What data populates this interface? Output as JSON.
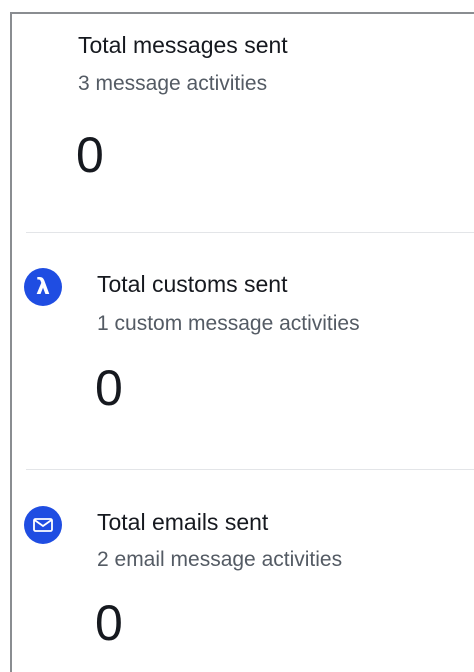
{
  "metrics": [
    {
      "title": "Total messages sent",
      "subtitle": "3 message activities",
      "value": "0"
    },
    {
      "title": "Total customs sent",
      "subtitle": "1 custom message activities",
      "value": "0",
      "icon": "lambda-icon",
      "icon_glyph": "λ"
    },
    {
      "title": "Total emails sent",
      "subtitle": "2 email message activities",
      "value": "0",
      "icon": "envelope-icon"
    }
  ],
  "colors": {
    "icon_bg": "#1f4de2",
    "title_text": "#16191f",
    "subtitle_text": "#545b64",
    "panel_border": "#8a8d91",
    "divider": "#e3e5e8"
  }
}
